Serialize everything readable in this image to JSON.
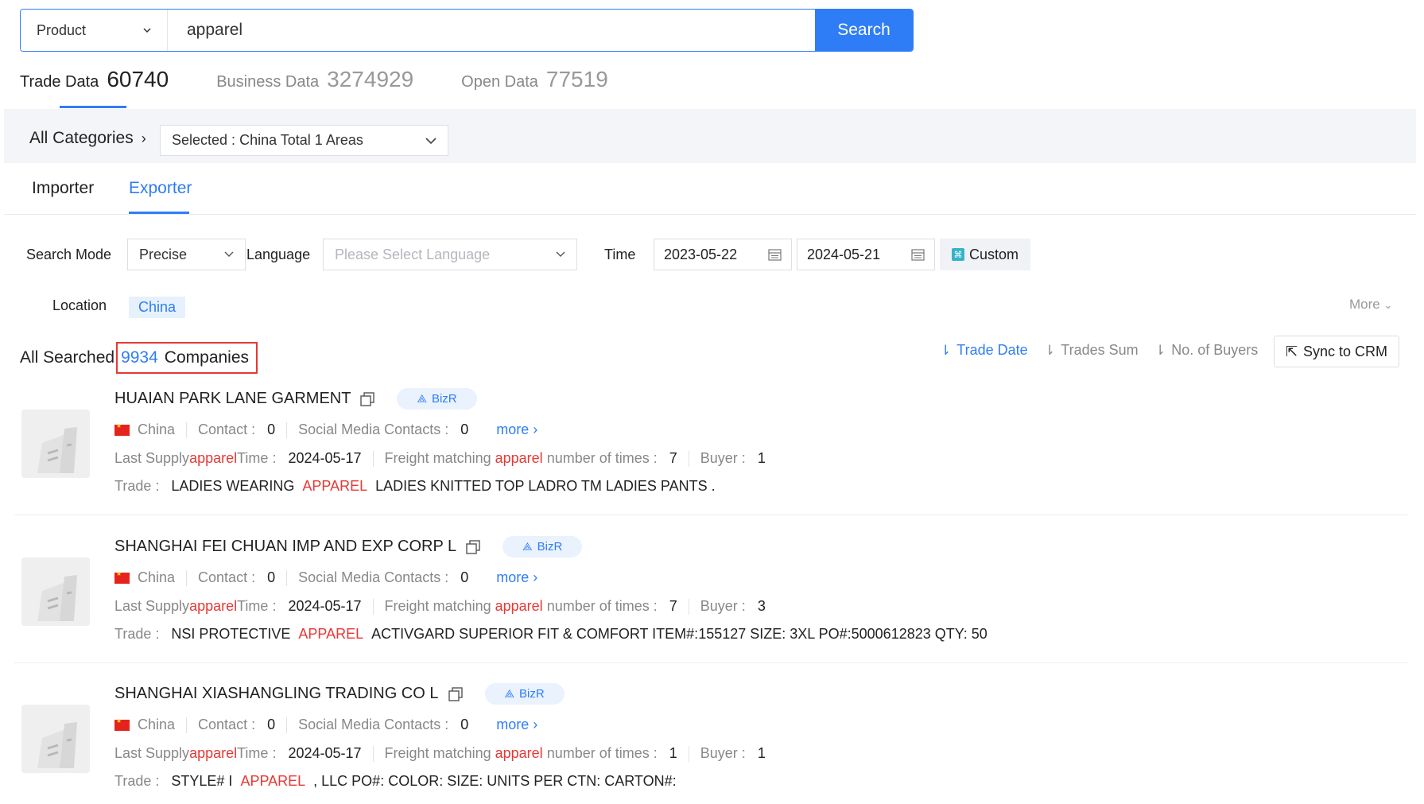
{
  "search": {
    "type_label": "Product",
    "value": "apparel",
    "button_label": "Search"
  },
  "data_tabs": [
    {
      "label": "Trade Data",
      "count": "60740"
    },
    {
      "label": "Business Data",
      "count": "3274929"
    },
    {
      "label": "Open Data",
      "count": "77519"
    }
  ],
  "categories": {
    "label": "All Categories",
    "selected_prefix": "Selected :",
    "selected_value": "China Total 1 Areas"
  },
  "role_tabs": [
    "Importer",
    "Exporter"
  ],
  "filters": {
    "search_mode_label": "Search Mode",
    "search_mode_value": "Precise",
    "language_label": "Language",
    "language_placeholder": "Please Select Language",
    "time_label": "Time",
    "start_date": "2023-05-22",
    "end_date": "2024-05-21",
    "custom_label": "Custom",
    "location_label": "Location",
    "location_value": "China",
    "more_label": "More"
  },
  "results": {
    "prefix": "All Searched",
    "count": "9934",
    "suffix": "Companies",
    "sort": [
      "Trade Date",
      "Trades Sum",
      "No. of Buyers"
    ],
    "sync_label": "Sync to CRM"
  },
  "labels": {
    "country": "China",
    "contact": "Contact :",
    "social": "Social Media Contacts :",
    "more": "more",
    "last_supply": "Last Supply",
    "keyword": "apparel",
    "time": "Time :",
    "freight": "Freight matching",
    "times": "number of times :",
    "buyer": "Buyer :",
    "trade": "Trade :",
    "bizr": "BizR"
  },
  "companies": [
    {
      "name": "HUAIAN PARK LANE GARMENT",
      "contact": "0",
      "social": "0",
      "last_supply_date": "2024-05-17",
      "freight_times": "7",
      "buyers": "1",
      "trade_before": "LADIES WEARING",
      "trade_keyword": "APPAREL",
      "trade_after": "LADIES KNITTED TOP LADRO TM LADIES PANTS ."
    },
    {
      "name": "SHANGHAI FEI CHUAN IMP AND EXP CORP L",
      "contact": "0",
      "social": "0",
      "last_supply_date": "2024-05-17",
      "freight_times": "7",
      "buyers": "3",
      "trade_before": "NSI PROTECTIVE",
      "trade_keyword": "APPAREL",
      "trade_after": "ACTIVGARD SUPERIOR FIT & COMFORT ITEM#:155127 SIZE: 3XL PO#:5000612823 QTY: 50"
    },
    {
      "name": "SHANGHAI XIASHANGLING TRADING CO L",
      "contact": "0",
      "social": "0",
      "last_supply_date": "2024-05-17",
      "freight_times": "1",
      "buyers": "1",
      "trade_before": "STYLE# I",
      "trade_keyword": "APPAREL",
      "trade_after": ", LLC PO#: COLOR: SIZE: UNITS PER CTN: CARTON#:"
    }
  ],
  "colors": {
    "accent": "#2f7df6",
    "highlight": "#e53935",
    "band": "#f3f5f8"
  }
}
